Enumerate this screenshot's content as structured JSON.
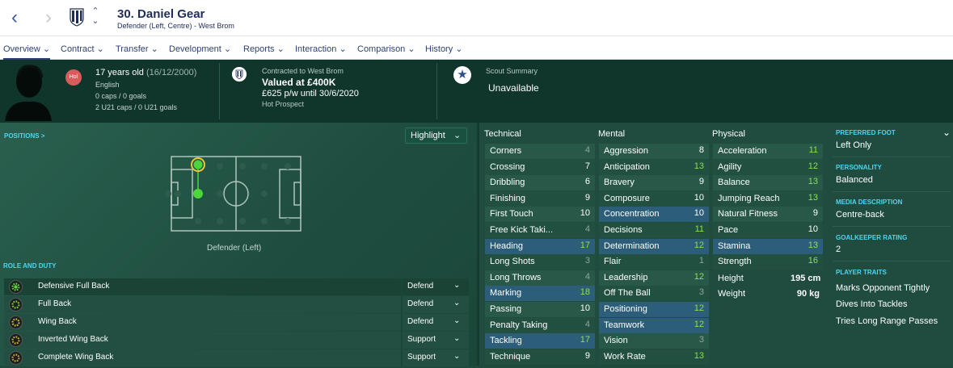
{
  "header": {
    "title": "30. Daniel Gear",
    "subtitle": "Defender (Left, Centre) - West Brom"
  },
  "nav": {
    "back": "‹",
    "forward": "›",
    "up": "⌃",
    "down": "⌄"
  },
  "tabs": [
    {
      "label": "Overview",
      "chev": "⌄"
    },
    {
      "label": "Contract",
      "chev": "⌄"
    },
    {
      "label": "Transfer",
      "chev": "⌄"
    },
    {
      "label": "Development",
      "chev": "⌄"
    },
    {
      "label": "Reports",
      "chev": "⌄"
    },
    {
      "label": "Interaction",
      "chev": "⌄"
    },
    {
      "label": "Comparison",
      "chev": "⌄"
    },
    {
      "label": "History",
      "chev": "⌄"
    }
  ],
  "player": {
    "badge": "Hol",
    "age": "17 years old",
    "dob": "(16/12/2000)",
    "nationality": "English",
    "caps": "0 caps / 0 goals",
    "u21": "2 U21 caps / 0 U21 goals"
  },
  "contract": {
    "label": "Contracted to West Brom",
    "valued": "Valued at £400K",
    "wage": "£625 p/w until 30/6/2020",
    "status": "Hot Prospect"
  },
  "scout": {
    "label": "Scout Summary",
    "value": "Unavailable"
  },
  "positions": {
    "label": "POSITIONS >",
    "highlight": "Highlight",
    "highlight_chev": "⌄",
    "caption": "Defender (Left)"
  },
  "roles": {
    "label": "ROLE AND DUTY",
    "items": [
      {
        "name": "Defensive Full Back",
        "duty": "Defend",
        "chev": "⌄"
      },
      {
        "name": "Full Back",
        "duty": "Defend",
        "chev": "⌄"
      },
      {
        "name": "Wing Back",
        "duty": "Defend",
        "chev": "⌄"
      },
      {
        "name": "Inverted Wing Back",
        "duty": "Support",
        "chev": "⌄"
      },
      {
        "name": "Complete Wing Back",
        "duty": "Support",
        "chev": "⌄"
      }
    ]
  },
  "attributes": {
    "technical_title": "Technical",
    "mental_title": "Mental",
    "physical_title": "Physical",
    "technical": [
      {
        "name": "Corners",
        "value": "4"
      },
      {
        "name": "Crossing",
        "value": "7"
      },
      {
        "name": "Dribbling",
        "value": "6"
      },
      {
        "name": "Finishing",
        "value": "9"
      },
      {
        "name": "First Touch",
        "value": "10"
      },
      {
        "name": "Free Kick Taki...",
        "value": "4"
      },
      {
        "name": "Heading",
        "value": "17"
      },
      {
        "name": "Long Shots",
        "value": "3"
      },
      {
        "name": "Long Throws",
        "value": "4"
      },
      {
        "name": "Marking",
        "value": "18"
      },
      {
        "name": "Passing",
        "value": "10"
      },
      {
        "name": "Penalty Taking",
        "value": "4"
      },
      {
        "name": "Tackling",
        "value": "17"
      },
      {
        "name": "Technique",
        "value": "9"
      }
    ],
    "mental": [
      {
        "name": "Aggression",
        "value": "8"
      },
      {
        "name": "Anticipation",
        "value": "13"
      },
      {
        "name": "Bravery",
        "value": "9"
      },
      {
        "name": "Composure",
        "value": "10"
      },
      {
        "name": "Concentration",
        "value": "10"
      },
      {
        "name": "Decisions",
        "value": "11"
      },
      {
        "name": "Determination",
        "value": "12"
      },
      {
        "name": "Flair",
        "value": "1"
      },
      {
        "name": "Leadership",
        "value": "12"
      },
      {
        "name": "Off The Ball",
        "value": "3"
      },
      {
        "name": "Positioning",
        "value": "12"
      },
      {
        "name": "Teamwork",
        "value": "12"
      },
      {
        "name": "Vision",
        "value": "3"
      },
      {
        "name": "Work Rate",
        "value": "13"
      }
    ],
    "physical": [
      {
        "name": "Acceleration",
        "value": "11"
      },
      {
        "name": "Agility",
        "value": "12"
      },
      {
        "name": "Balance",
        "value": "13"
      },
      {
        "name": "Jumping Reach",
        "value": "13"
      },
      {
        "name": "Natural Fitness",
        "value": "9"
      },
      {
        "name": "Pace",
        "value": "10"
      },
      {
        "name": "Stamina",
        "value": "13"
      },
      {
        "name": "Strength",
        "value": "16"
      }
    ],
    "height_label": "Height",
    "height": "195 cm",
    "weight_label": "Weight",
    "weight": "90 kg"
  },
  "profile": {
    "chev": "⌄",
    "preferred_foot_label": "PREFERRED FOOT",
    "preferred_foot": "Left Only",
    "personality_label": "PERSONALITY",
    "personality": "Balanced",
    "media_label": "MEDIA DESCRIPTION",
    "media": "Centre-back",
    "gk_label": "GOALKEEPER RATING",
    "gk": "2",
    "traits_label": "PLAYER TRAITS",
    "traits": [
      "Marks Opponent Tightly",
      "Dives Into Tackles",
      "Tries Long Range Passes"
    ]
  }
}
